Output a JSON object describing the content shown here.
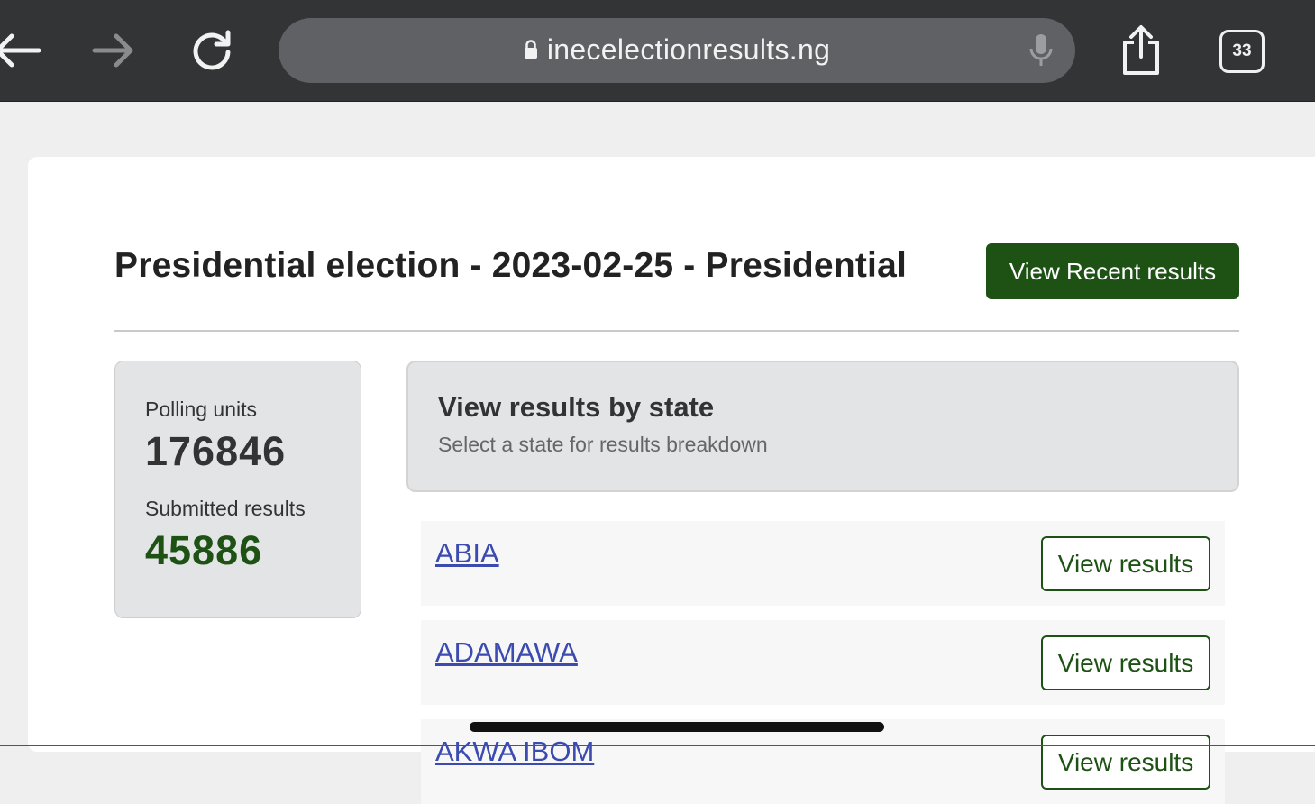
{
  "browser": {
    "url": "inecelectionresults.ng",
    "tab_count": "33"
  },
  "page": {
    "title": "Presidential election - 2023-02-25 - Presidential",
    "recent_button": "View Recent results"
  },
  "stats": {
    "polling_label": "Polling units",
    "polling_value": "176846",
    "submitted_label": "Submitted results",
    "submitted_value": "45886"
  },
  "states_panel": {
    "heading": "View results by state",
    "subheading": "Select a state for results breakdown",
    "rows": [
      {
        "name": "ABIA",
        "button": "View results"
      },
      {
        "name": "ADAMAWA",
        "button": "View results"
      },
      {
        "name": "AKWA IBOM",
        "button": "View results"
      }
    ]
  },
  "colors": {
    "brand_green": "#1d5214",
    "link_blue": "#3b4bb0",
    "toolbar_bg": "#333436"
  }
}
